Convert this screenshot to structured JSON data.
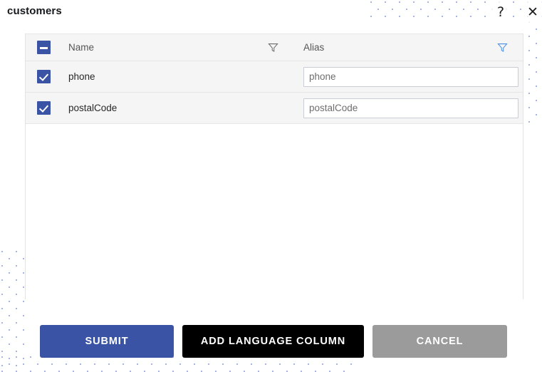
{
  "dialog": {
    "title": "customers",
    "help_icon": "question-mark-icon",
    "close_icon": "close-x-icon",
    "help_glyph": "?",
    "close_glyph": "✕"
  },
  "table": {
    "select_all_state": "indeterminate",
    "columns": [
      {
        "key": "select",
        "label": ""
      },
      {
        "key": "name",
        "label": "Name",
        "filter_icon": "filter-icon",
        "filter_active": false
      },
      {
        "key": "alias",
        "label": "Alias",
        "filter_icon": "filter-icon",
        "filter_active": true
      }
    ],
    "rows": [
      {
        "checked": true,
        "name": "phone",
        "alias_value": "phone",
        "alias_placeholder": "phone"
      },
      {
        "checked": true,
        "name": "postalCode",
        "alias_value": "postalCode",
        "alias_placeholder": "postalCode"
      }
    ]
  },
  "actions": {
    "submit_label": "SUBMIT",
    "add_language_column_label": "ADD LANGUAGE COLUMN",
    "cancel_label": "CANCEL"
  },
  "colors": {
    "accent_blue": "#3a53a4",
    "filter_active_blue": "#4a90e2",
    "black_button": "#000000",
    "cancel_gray": "#9b9b9b",
    "header_gray": "#f5f5f5",
    "dot_pattern": "#9aa7e0"
  }
}
